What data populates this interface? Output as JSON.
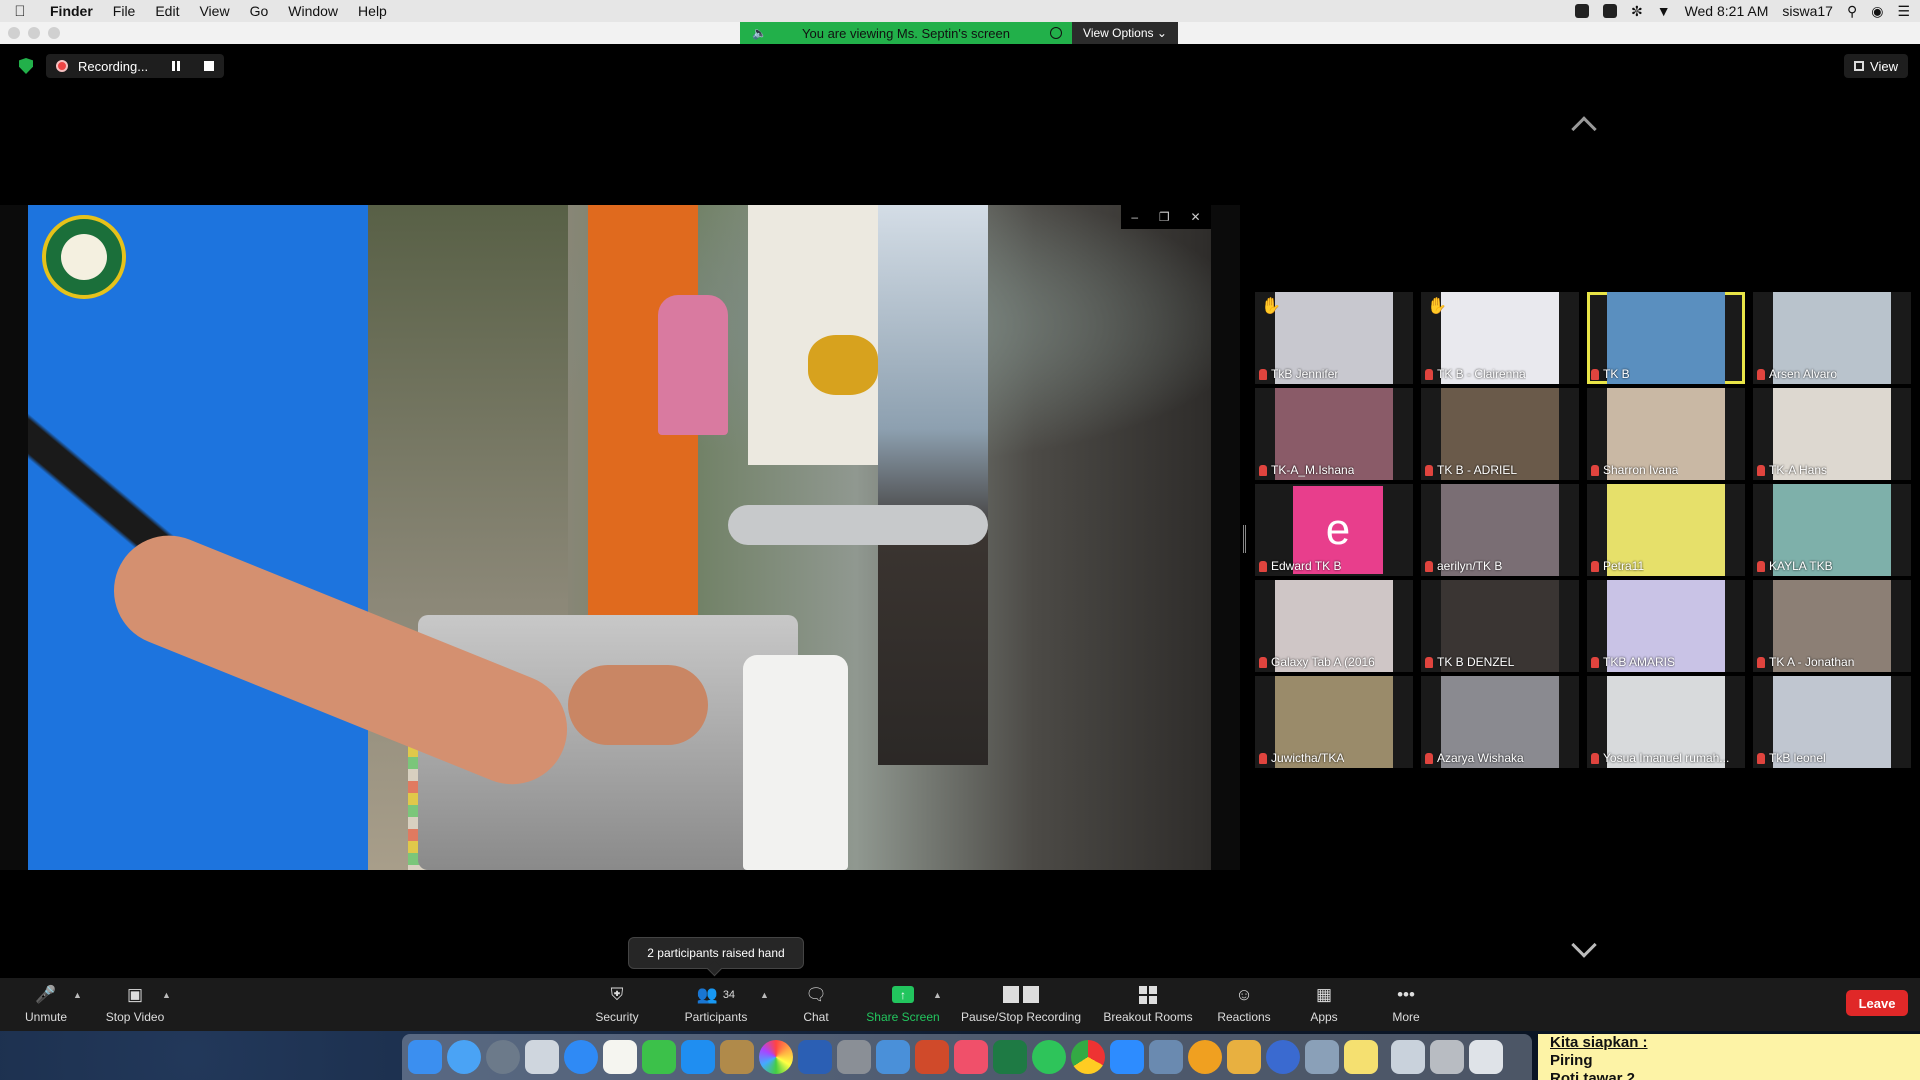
{
  "menubar": {
    "app": "Finder",
    "items": [
      "File",
      "Edit",
      "View",
      "Go",
      "Window",
      "Help"
    ],
    "clock": "Wed 8:21 AM",
    "user": "siswa17"
  },
  "share_banner": {
    "text": "You are viewing Ms. Septin's screen",
    "view_options": "View Options"
  },
  "recording": {
    "label": "Recording..."
  },
  "view_button": {
    "label": "View"
  },
  "participants": [
    {
      "name": "TkB Jennifer",
      "hand": true,
      "color": "#c8c8cf"
    },
    {
      "name": "TK B - Clairenna",
      "hand": true,
      "color": "#e9e9ee"
    },
    {
      "name": "TK B",
      "active": true,
      "color": "#5a8fbf"
    },
    {
      "name": "Arsen Alvaro",
      "color": "#b9c3cc"
    },
    {
      "name": "TK-A_M.Ishana",
      "color": "#8a5b68"
    },
    {
      "name": "TK B - ADRIEL",
      "color": "#6a5a4a"
    },
    {
      "name": "Sharron Ivana",
      "color": "#c9b8a4"
    },
    {
      "name": "TK-A Hans",
      "color": "#ddd8d0"
    },
    {
      "name": "Edward TK B",
      "letter": "e",
      "color": "#1a1a1a"
    },
    {
      "name": "aerilyn/TK B",
      "color": "#7a6e74"
    },
    {
      "name": "Petra11",
      "color": "#e6e06a"
    },
    {
      "name": "KAYLA TKB",
      "color": "#7eb0aa"
    },
    {
      "name": "Galaxy Tab A (2016",
      "color": "#cfc6c6"
    },
    {
      "name": "TK B DENZEL",
      "color": "#3a3533"
    },
    {
      "name": "TKB AMARIS",
      "color": "#c9c3e6"
    },
    {
      "name": "TK A - Jonathan",
      "color": "#8c7f75"
    },
    {
      "name": "Juwictha/TKA",
      "color": "#9a8b6a"
    },
    {
      "name": "Azarya Wishaka",
      "color": "#8a8a90"
    },
    {
      "name": "Yosua Imanuel rumah...",
      "color": "#d8dadc"
    },
    {
      "name": "TkB leonel",
      "color": "#c0c6d0"
    }
  ],
  "tooltip": "2 participants raised hand",
  "toolbar": {
    "unmute": "Unmute",
    "stop_video": "Stop Video",
    "security": "Security",
    "participants": "Participants",
    "participant_count": "34",
    "chat": "Chat",
    "share_screen": "Share Screen",
    "pause_recording": "Pause/Stop Recording",
    "breakout_rooms": "Breakout Rooms",
    "reactions": "Reactions",
    "apps": "Apps",
    "more": "More",
    "leave": "Leave"
  },
  "sticky_note": {
    "lines": [
      "Kita siapkan :",
      "Piring",
      "Roti tawar 2"
    ]
  },
  "colors": {
    "banner_green": "#22b04a",
    "active_speaker": "#e8e447",
    "leave_red": "#e02828",
    "share_green": "#22c55e"
  }
}
